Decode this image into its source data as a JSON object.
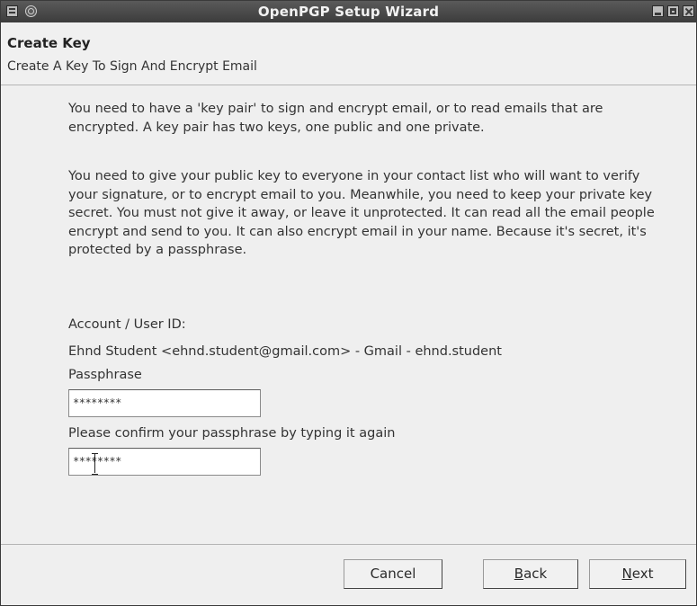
{
  "window": {
    "title": "OpenPGP Setup Wizard",
    "controls": [
      "window-menu-icon",
      "pin-icon",
      "minimize-icon",
      "maximize-icon",
      "close-icon"
    ]
  },
  "header": {
    "title": "Create Key",
    "subtitle": "Create A Key To Sign And Encrypt Email"
  },
  "body": {
    "paragraph1": "You need to have a 'key pair' to sign and encrypt email, or to read emails that are encrypted. A key pair has two keys, one public and one private.",
    "paragraph2": "You need to give your public key to everyone in your contact list who will want to verify your signature, or to encrypt email to you. Meanwhile, you need to keep your private key secret. You must not give it away, or leave it unprotected. It can read all the email people encrypt and send to you. It can also encrypt email in your name. Because it's secret, it's protected by a passphrase.",
    "account_label": "Account / User ID:",
    "account_value": "Ehnd Student <ehnd.student@gmail.com> - Gmail - ehnd.student",
    "passphrase_label": "Passphrase",
    "passphrase_value": "********",
    "confirm_label": "Please confirm your passphrase by typing it again",
    "confirm_value": "********"
  },
  "buttons": {
    "cancel": "Cancel",
    "back_mnemonic": "B",
    "back_rest": "ack",
    "next_mnemonic": "N",
    "next_rest": "ext"
  }
}
